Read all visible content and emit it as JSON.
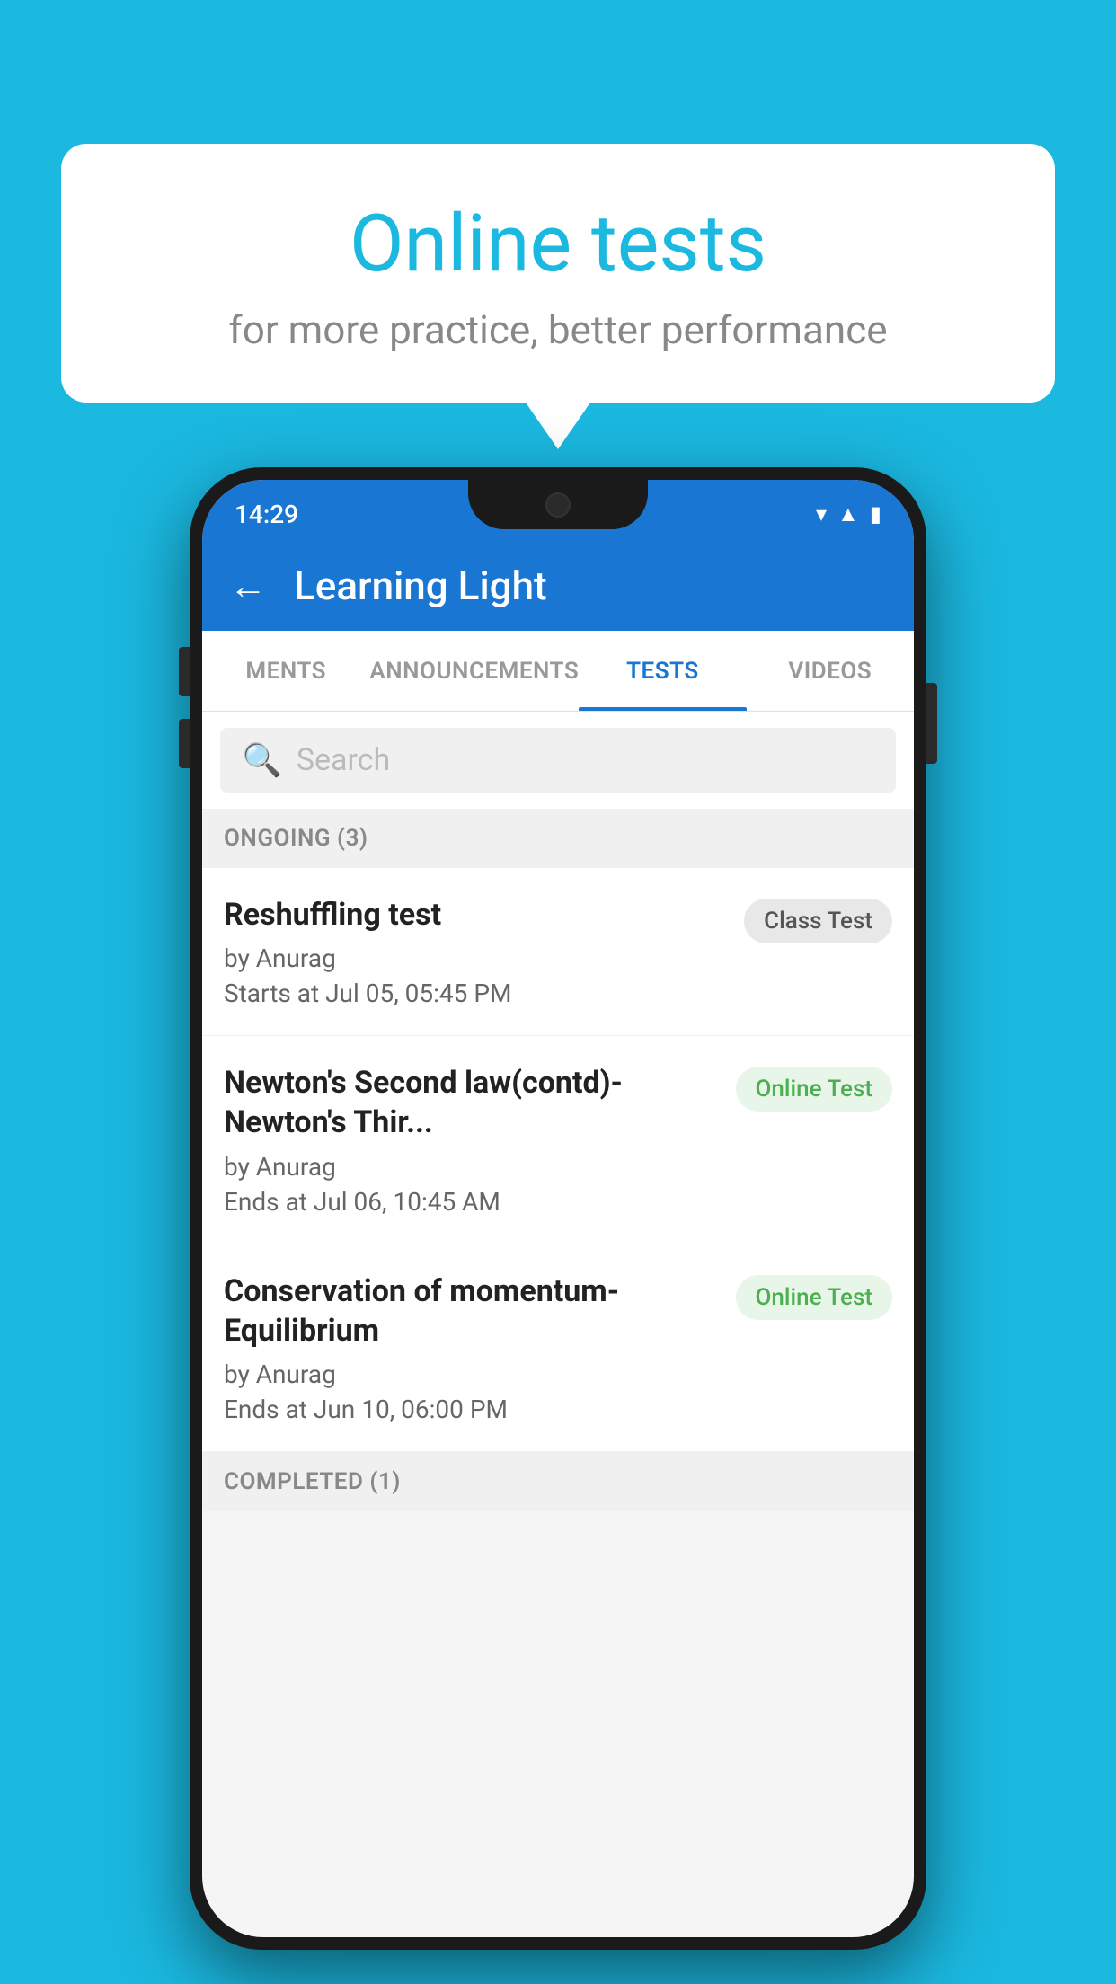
{
  "background_color": "#1BB8E0",
  "bubble": {
    "title": "Online tests",
    "subtitle": "for more practice, better performance"
  },
  "phone": {
    "status_bar": {
      "time": "14:29",
      "icons": [
        "wifi",
        "signal",
        "battery"
      ]
    },
    "app_bar": {
      "title": "Learning Light",
      "back_label": "←"
    },
    "tabs": [
      {
        "label": "MENTS",
        "active": false
      },
      {
        "label": "ANNOUNCEMENTS",
        "active": false
      },
      {
        "label": "TESTS",
        "active": true
      },
      {
        "label": "VIDEOS",
        "active": false
      }
    ],
    "search": {
      "placeholder": "Search"
    },
    "section_ongoing": {
      "label": "ONGOING (3)"
    },
    "tests": [
      {
        "name": "Reshuffling test",
        "by": "by Anurag",
        "date_label": "Starts at",
        "date": "Jul 05, 05:45 PM",
        "badge": "Class Test",
        "badge_type": "class"
      },
      {
        "name": "Newton's Second law(contd)-Newton's Thir...",
        "by": "by Anurag",
        "date_label": "Ends at",
        "date": "Jul 06, 10:45 AM",
        "badge": "Online Test",
        "badge_type": "online"
      },
      {
        "name": "Conservation of momentum-Equilibrium",
        "by": "by Anurag",
        "date_label": "Ends at",
        "date": "Jun 10, 06:00 PM",
        "badge": "Online Test",
        "badge_type": "online"
      }
    ],
    "section_completed": {
      "label": "COMPLETED (1)"
    }
  }
}
